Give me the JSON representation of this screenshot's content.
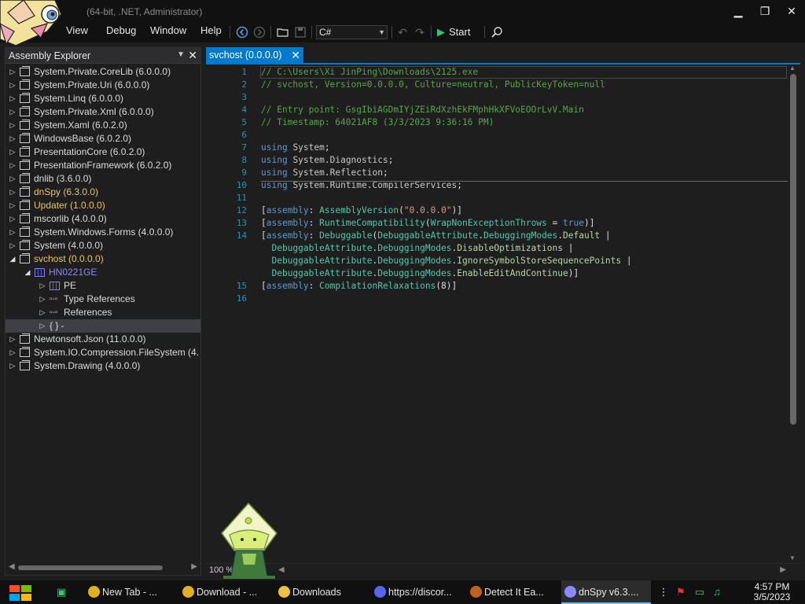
{
  "window": {
    "title": "(64-bit, .NET, Administrator)",
    "minimize": "▁",
    "restore": "❐",
    "close": "✕"
  },
  "menu": {
    "view": "View",
    "debug": "Debug",
    "window": "Window",
    "help": "Help"
  },
  "toolbar": {
    "language": "C#",
    "start_label": "Start"
  },
  "explorer": {
    "title": "Assembly Explorer",
    "items": [
      {
        "label": "System.Private.CoreLib (6.0.0.0)",
        "level": 0,
        "kind": "asm",
        "color": "#dcdcdc"
      },
      {
        "label": "System.Private.Uri (6.0.0.0)",
        "level": 0,
        "kind": "asm",
        "color": "#dcdcdc"
      },
      {
        "label": "System.Linq (6.0.0.0)",
        "level": 0,
        "kind": "asm",
        "color": "#dcdcdc"
      },
      {
        "label": "System.Private.Xml (6.0.0.0)",
        "level": 0,
        "kind": "asm",
        "color": "#dcdcdc"
      },
      {
        "label": "System.Xaml (6.0.2.0)",
        "level": 0,
        "kind": "asm",
        "color": "#dcdcdc"
      },
      {
        "label": "WindowsBase (6.0.2.0)",
        "level": 0,
        "kind": "asm",
        "color": "#dcdcdc"
      },
      {
        "label": "PresentationCore (6.0.2.0)",
        "level": 0,
        "kind": "asm",
        "color": "#dcdcdc"
      },
      {
        "label": "PresentationFramework (6.0.2.0)",
        "level": 0,
        "kind": "asm",
        "color": "#dcdcdc"
      },
      {
        "label": "dnlib (3.6.0.0)",
        "level": 0,
        "kind": "asm",
        "color": "#dcdcdc"
      },
      {
        "label": "dnSpy (6.3.0.0)",
        "level": 0,
        "kind": "asm",
        "color": "#e8c46b"
      },
      {
        "label": "Updater (1.0.0.0)",
        "level": 0,
        "kind": "asm",
        "color": "#e8c46b"
      },
      {
        "label": "mscorlib (4.0.0.0)",
        "level": 0,
        "kind": "asm",
        "color": "#dcdcdc"
      },
      {
        "label": "System.Windows.Forms (4.0.0.0)",
        "level": 0,
        "kind": "asm",
        "color": "#dcdcdc"
      },
      {
        "label": "System (4.0.0.0)",
        "level": 0,
        "kind": "asm",
        "color": "#dcdcdc"
      },
      {
        "label": "svchost (0.0.0.0)",
        "level": 0,
        "kind": "asm",
        "color": "#e8c46b",
        "expanded": true
      },
      {
        "label": "HN0221GE",
        "level": 1,
        "kind": "mod",
        "color": "#8a8aff",
        "expanded": true
      },
      {
        "label": "PE",
        "level": 2,
        "kind": "mod",
        "color": "#dcdcdc"
      },
      {
        "label": "Type References",
        "level": 2,
        "kind": "ref",
        "color": "#dcdcdc"
      },
      {
        "label": "References",
        "level": 2,
        "kind": "ref",
        "color": "#dcdcdc"
      },
      {
        "label": "{ }  -",
        "level": 2,
        "kind": "ns",
        "color": "#dcdcdc",
        "selected": true
      },
      {
        "label": "Newtonsoft.Json (11.0.0.0)",
        "level": 0,
        "kind": "asm",
        "color": "#dcdcdc"
      },
      {
        "label": "System.IO.Compression.FileSystem (4.",
        "level": 0,
        "kind": "asm",
        "color": "#dcdcdc"
      },
      {
        "label": "System.Drawing (4.0.0.0)",
        "level": 0,
        "kind": "asm",
        "color": "#dcdcdc"
      }
    ]
  },
  "tab": {
    "label": "svchost (0.0.0.0)"
  },
  "editor": {
    "zoom": "100 %",
    "lines": [
      {
        "n": "1",
        "segs": [
          [
            "cm",
            "// C:\\Users\\Xi JinPing\\Downloads\\2125.exe"
          ]
        ]
      },
      {
        "n": "2",
        "segs": [
          [
            "cm",
            "// svchost, Version=0.0.0.0, Culture=neutral, PublicKeyToken=null"
          ]
        ]
      },
      {
        "n": "3",
        "segs": []
      },
      {
        "n": "4",
        "segs": [
          [
            "cm",
            "// Entry point: GsgIbiAGDmIYjZEiRdXzhEkFMphHkXFVoEOOrLvV.Main"
          ]
        ]
      },
      {
        "n": "5",
        "segs": [
          [
            "cm",
            "// Timestamp: 64021AF8 (3/3/2023 9:36:16 PM)"
          ]
        ]
      },
      {
        "n": "6",
        "segs": []
      },
      {
        "n": "7",
        "segs": [
          [
            "kw",
            "using"
          ],
          [
            "",
            " "
          ],
          [
            "ns",
            "System"
          ],
          [
            "",
            ";"
          ]
        ]
      },
      {
        "n": "8",
        "segs": [
          [
            "kw",
            "using"
          ],
          [
            "",
            " "
          ],
          [
            "ns",
            "System"
          ],
          [
            "",
            "."
          ],
          [
            "ns",
            "Diagnostics"
          ],
          [
            "",
            ";"
          ]
        ]
      },
      {
        "n": "9",
        "segs": [
          [
            "kw",
            "using"
          ],
          [
            "",
            " "
          ],
          [
            "ns",
            "System"
          ],
          [
            "",
            "."
          ],
          [
            "ns",
            "Reflection"
          ],
          [
            "",
            ";"
          ]
        ]
      },
      {
        "n": "10",
        "segs": [
          [
            "kw",
            "using"
          ],
          [
            "",
            " "
          ],
          [
            "ns",
            "System"
          ],
          [
            "",
            "."
          ],
          [
            "ns",
            "Runtime"
          ],
          [
            "",
            "."
          ],
          [
            "ns",
            "CompilerServices"
          ],
          [
            "",
            ";"
          ]
        ]
      },
      {
        "n": "11",
        "segs": []
      },
      {
        "n": "12",
        "segs": [
          [
            "",
            "["
          ],
          [
            "kw",
            "assembly"
          ],
          [
            "",
            ": "
          ],
          [
            "ty",
            "AssemblyVersion"
          ],
          [
            "",
            "("
          ],
          [
            "st",
            "\"0.0.0.0\""
          ],
          [
            "",
            ")]"
          ]
        ]
      },
      {
        "n": "13",
        "segs": [
          [
            "",
            "["
          ],
          [
            "kw",
            "assembly"
          ],
          [
            "",
            ": "
          ],
          [
            "ty",
            "RuntimeCompatibility"
          ],
          [
            "",
            "("
          ],
          [
            "ty",
            "WrapNonExceptionThrows"
          ],
          [
            "",
            " = "
          ],
          [
            "kw",
            "true"
          ],
          [
            "",
            ")]"
          ]
        ]
      },
      {
        "n": "14",
        "segs": [
          [
            "",
            "["
          ],
          [
            "kw",
            "assembly"
          ],
          [
            "",
            ": "
          ],
          [
            "ty",
            "Debuggable"
          ],
          [
            "",
            "("
          ],
          [
            "ty",
            "DebuggableAttribute"
          ],
          [
            "",
            "."
          ],
          [
            "ty",
            "DebuggingModes"
          ],
          [
            "",
            "."
          ],
          [
            "en",
            "Default"
          ],
          [
            "",
            " |"
          ]
        ]
      },
      {
        "n": "",
        "segs": [
          [
            "",
            "  "
          ],
          [
            "ty",
            "DebuggableAttribute"
          ],
          [
            "",
            "."
          ],
          [
            "ty",
            "DebuggingModes"
          ],
          [
            "",
            "."
          ],
          [
            "en",
            "DisableOptimizations"
          ],
          [
            "",
            " |"
          ]
        ]
      },
      {
        "n": "",
        "segs": [
          [
            "",
            "  "
          ],
          [
            "ty",
            "DebuggableAttribute"
          ],
          [
            "",
            "."
          ],
          [
            "ty",
            "DebuggingModes"
          ],
          [
            "",
            "."
          ],
          [
            "en",
            "IgnoreSymbolStoreSequencePoints"
          ],
          [
            "",
            " |"
          ]
        ]
      },
      {
        "n": "",
        "segs": [
          [
            "",
            "  "
          ],
          [
            "ty",
            "DebuggableAttribute"
          ],
          [
            "",
            "."
          ],
          [
            "ty",
            "DebuggingModes"
          ],
          [
            "",
            "."
          ],
          [
            "en",
            "EnableEditAndContinue"
          ],
          [
            "",
            ")]"
          ]
        ]
      },
      {
        "n": "15",
        "segs": [
          [
            "",
            "["
          ],
          [
            "kw",
            "assembly"
          ],
          [
            "",
            ": "
          ],
          [
            "ty",
            "CompilationRelaxations"
          ],
          [
            "",
            "(8)]"
          ]
        ]
      },
      {
        "n": "16",
        "segs": []
      }
    ]
  },
  "taskbar": {
    "tasks": [
      {
        "label": "New Tab - ...",
        "icon_color": "#e0b020",
        "icon": "chrome-icon"
      },
      {
        "label": "Download - ...",
        "icon_color": "#e0b020",
        "icon": "chrome-icon"
      },
      {
        "label": "Downloads",
        "icon_color": "#f0c040",
        "icon": "folder-icon"
      },
      {
        "label": "https://discor...",
        "icon_color": "#5865f2",
        "icon": "discord-icon"
      },
      {
        "label": "Detect It Ea...",
        "icon_color": "#c06020",
        "icon": "die-icon"
      },
      {
        "label": "dnSpy v6.3....",
        "icon_color": "#8a8aff",
        "icon": "dnspy-icon",
        "active": true
      }
    ],
    "time": "4:57 PM",
    "date": "3/5/2023"
  }
}
